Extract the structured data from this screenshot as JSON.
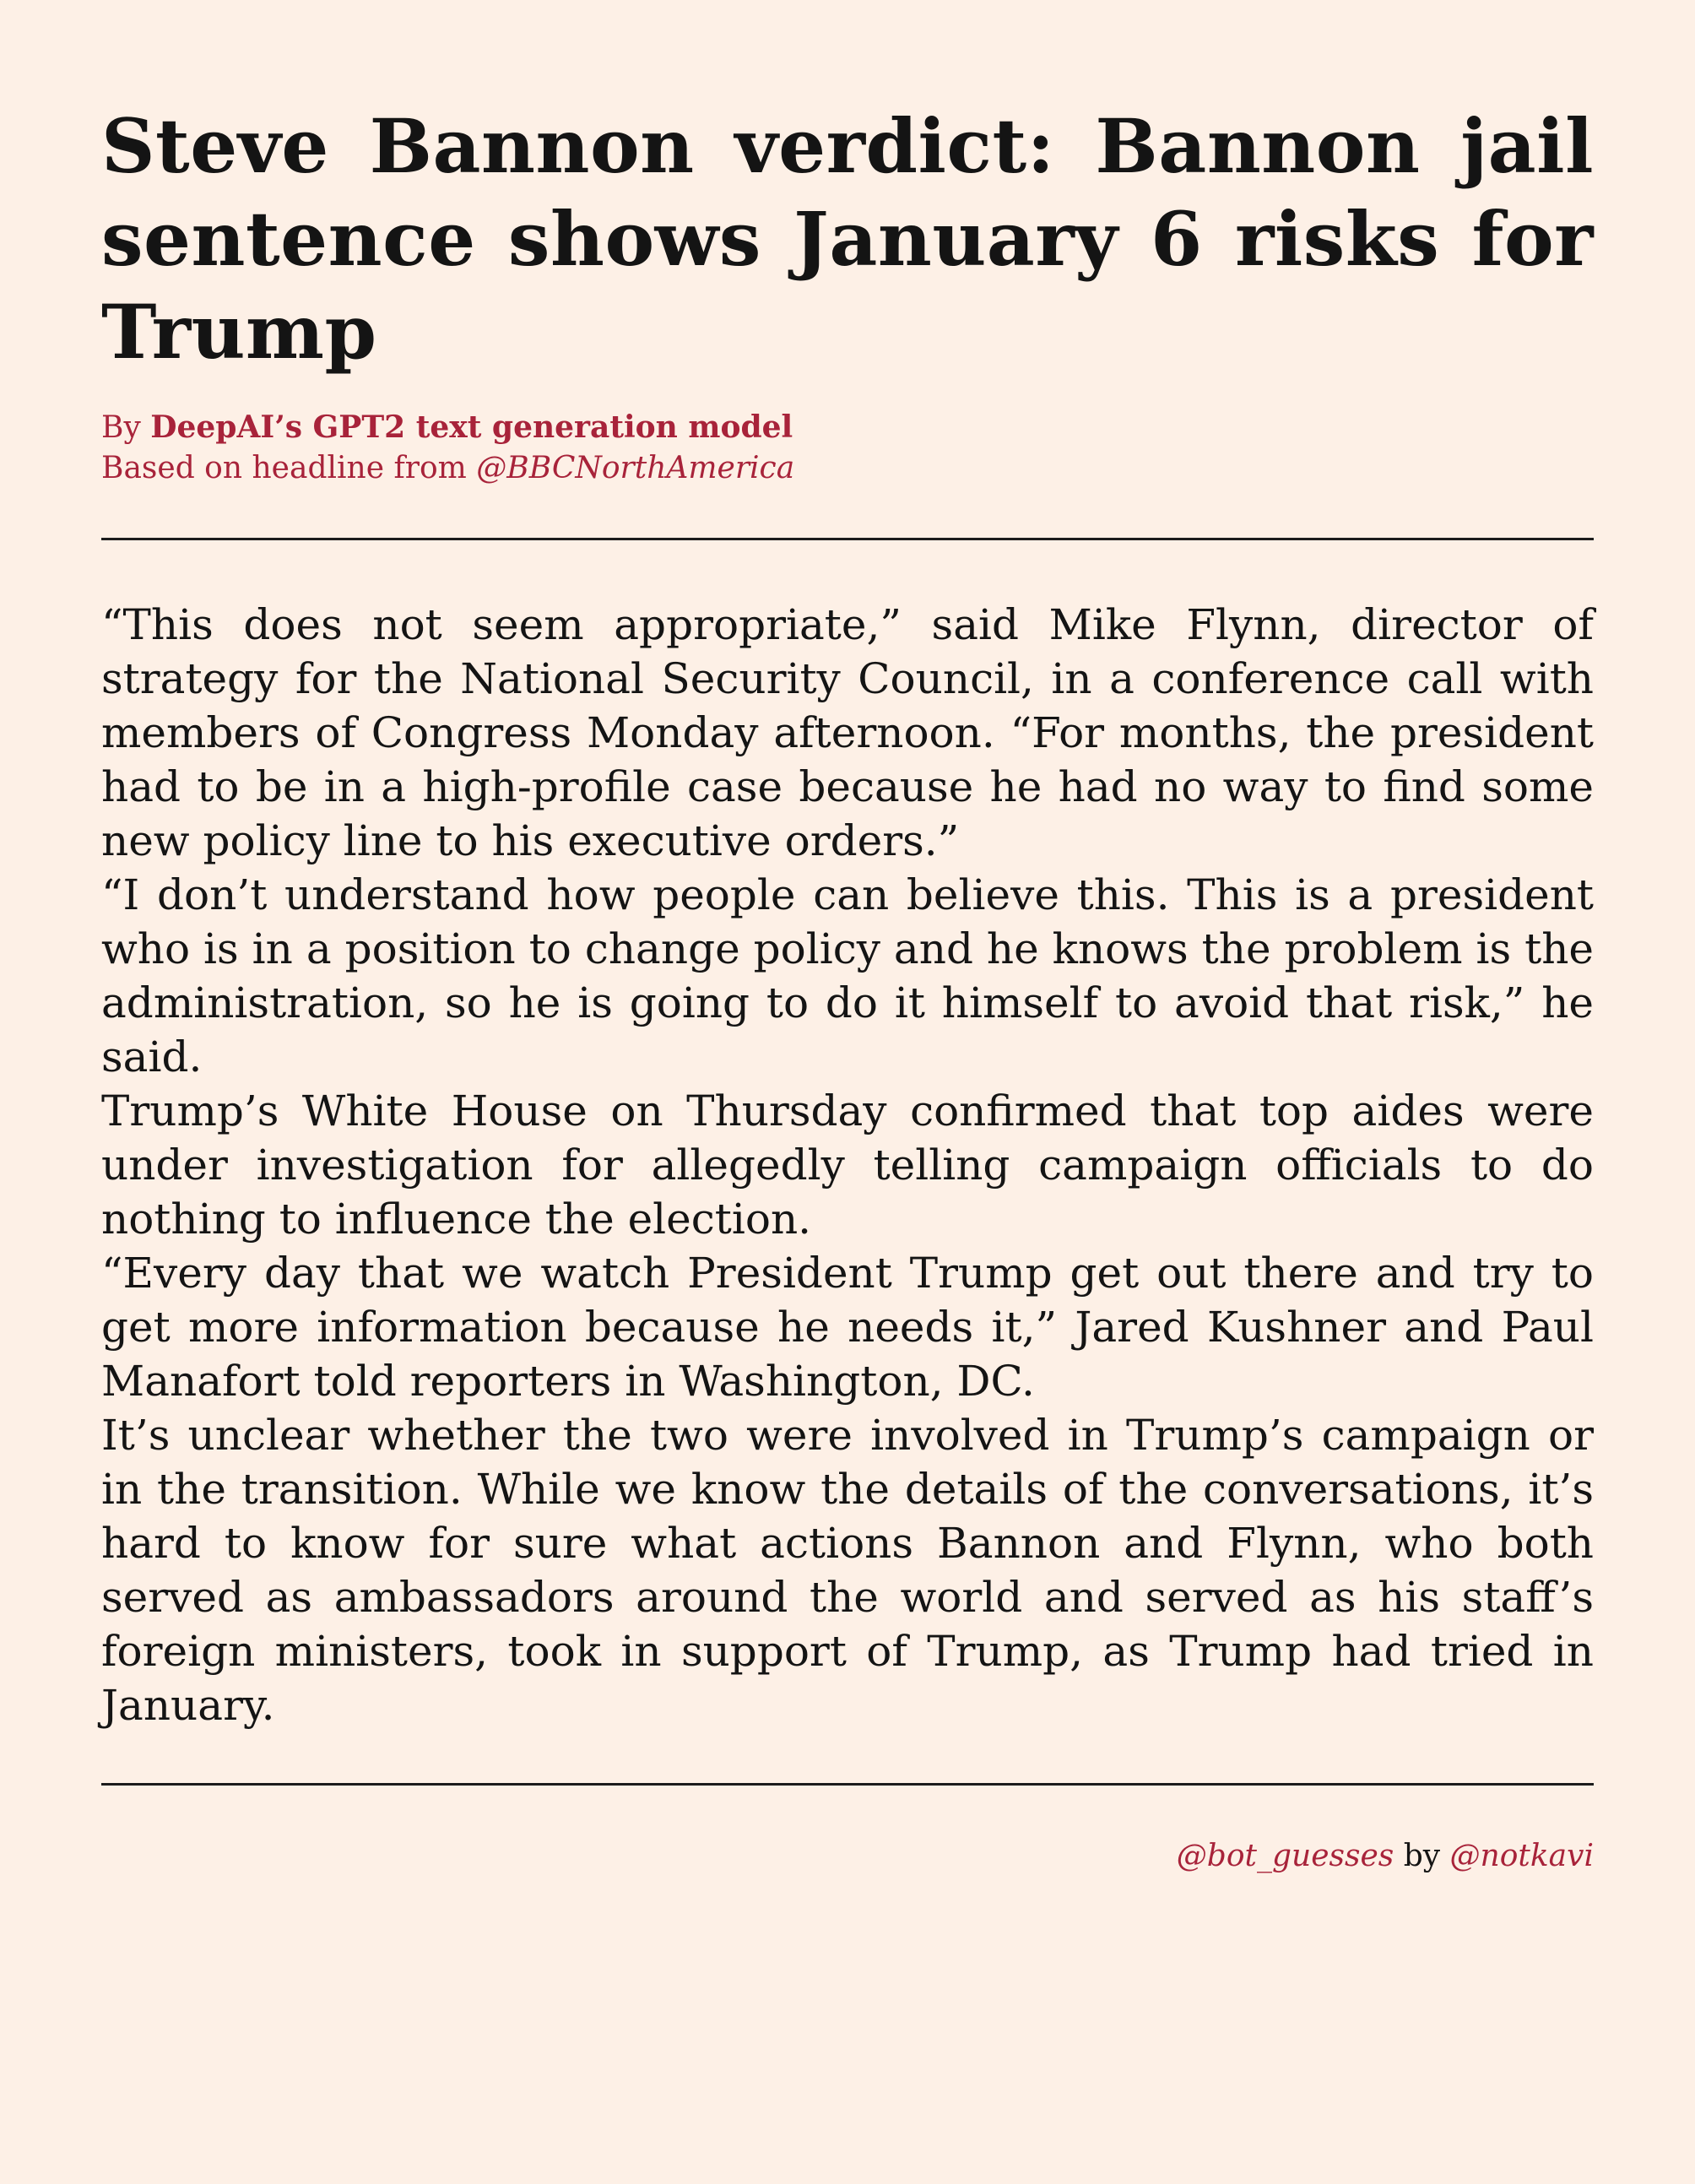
{
  "article": {
    "headline": "Steve Bannon verdict: Bannon jail sentence shows January 6 risks for Trump",
    "byline": {
      "by_prefix": "By ",
      "author": "DeepAI’s GPT2 text generation model",
      "based_on_prefix": "Based on headline from ",
      "source_handle": "@BBCNorthAmerica"
    },
    "paragraphs": [
      "“This does not seem appropriate,” said Mike Flynn, director of strategy for the National Security Council, in a conference call with members of Congress Monday afternoon. “For months, the president had to be in a high-profile case because he had no way to find some new policy line to his executive orders.”",
      "“I don’t understand how people can believe this. This is a president who is in a position to change policy and he knows the problem is the administration, so he is going to do it himself to avoid that risk,” he said.",
      "Trump’s White House on Thursday confirmed that top aides were under investigation for allegedly telling campaign officials to do nothing to influence the election.",
      "“Every day that we watch President Trump get out there and try to get more information because he needs it,” Jared Kushner and Paul Manafort told reporters in Washington, DC.",
      "It’s unclear whether the two were involved in Trump’s campaign or in the transition. While we know the details of the conversations, it’s hard to know for sure what actions Bannon and Flynn, who both served as ambassadors around the world and served as his staff’s foreign ministers, took in support of Trump, as Trump had tried in January."
    ]
  },
  "footer": {
    "bot_handle": "@bot_guesses",
    "by_text": " by ",
    "creator_handle": "@notkavi"
  },
  "colors": {
    "background": "#fdf0e6",
    "accent": "#a8233a",
    "text": "#141414"
  }
}
